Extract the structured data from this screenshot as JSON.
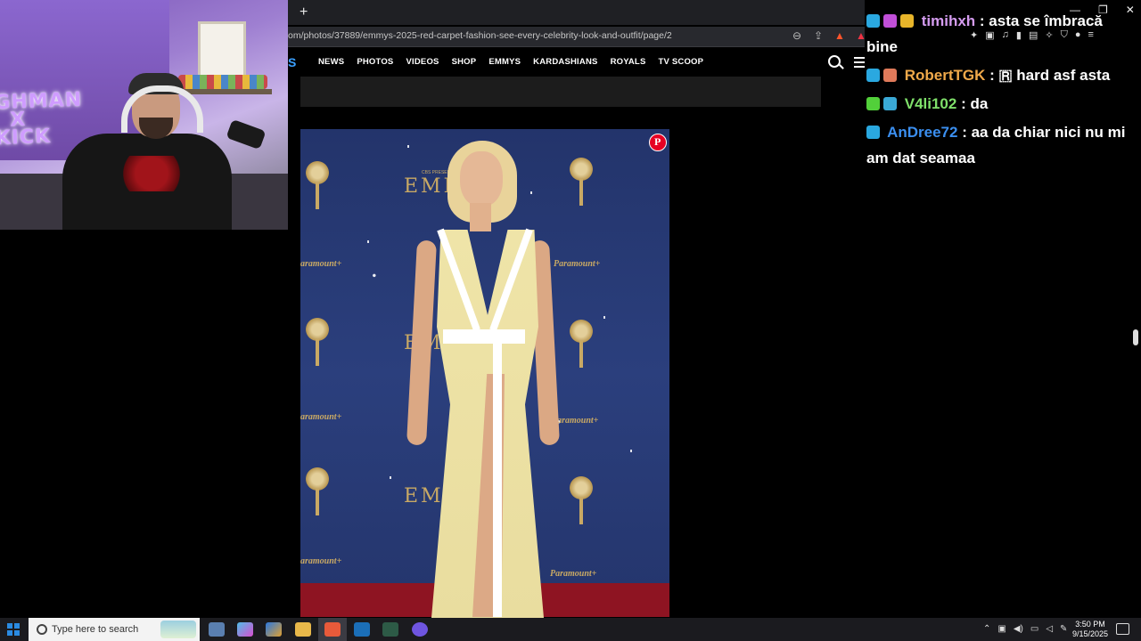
{
  "browser": {
    "new_tab_label": "+",
    "url": "om/photos/37889/emmys-2025-red-carpet-fashion-see-every-celebrity-look-and-outfit/page/2"
  },
  "site": {
    "logo_fragment": "S",
    "nav": [
      "NEWS",
      "PHOTOS",
      "VIDEOS",
      "SHOP",
      "EMMYS",
      "KARDASHIANS",
      "ROYALS",
      "TV SCOOP"
    ]
  },
  "photo": {
    "backdrop_emmy": "EMMYS",
    "backdrop_emmy_partial": "EM",
    "backdrop_sponsor": "Paramount+",
    "backdrop_sponsor_partial": "aramount+",
    "cbs_small": "CBS PRESENTS",
    "pin_label": "P"
  },
  "webcam": {
    "neon_sign": "GHMAN X KICK"
  },
  "chat": {
    "partial_top": "asta se îmbracă",
    "messages": [
      {
        "user": "timihxh",
        "user_color": "#d59cf0",
        "text": ": asta se îmbracă bine",
        "badge_color": "#2aa8e0"
      },
      {
        "user": "RobertTGK",
        "user_color": "#f0a94a",
        "text": ": 🇷 hard asf asta",
        "badge_color": "#2aa8e0"
      },
      {
        "user": "V4li102",
        "user_color": "#7fe06a",
        "text": ": da",
        "badge_color": "#52d03a"
      },
      {
        "user": "AnDree72",
        "user_color": "#3b8ff0",
        "text": ": aa da chiar nici nu mi am dat seamaa",
        "badge_color": "#2aa8e0"
      }
    ]
  },
  "taskbar": {
    "search_placeholder": "Type here to search",
    "time": "3:50 PM",
    "date": "9/15/2025"
  }
}
